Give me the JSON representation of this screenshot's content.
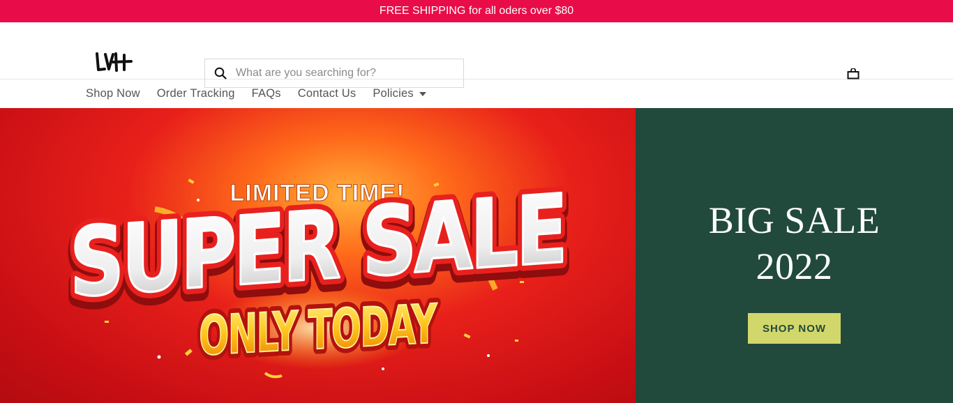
{
  "announcement": {
    "text": "FREE SHIPPING for all oders over $80"
  },
  "header": {
    "logo_text": "LVH",
    "search": {
      "placeholder": "What are you searching for?",
      "value": "",
      "icon": "search-icon"
    },
    "cart": {
      "icon": "bag-icon"
    }
  },
  "nav": {
    "items": [
      {
        "label": "Shop Now"
      },
      {
        "label": "Order Tracking"
      },
      {
        "label": "FAQs"
      },
      {
        "label": "Contact Us"
      },
      {
        "label": "Policies",
        "has_dropdown": true
      }
    ]
  },
  "hero": {
    "banner": {
      "line1": "LIMITED TIME!",
      "line2": "SUPER SALE",
      "line3": "ONLY TODAY"
    },
    "side": {
      "title_line1": "BIG SALE",
      "title_line2": "2022",
      "button_label": "SHOP NOW"
    },
    "colors": {
      "announce_bg": "#e80c48",
      "side_bg": "#214a3c",
      "button_bg": "#d2d76b"
    }
  }
}
